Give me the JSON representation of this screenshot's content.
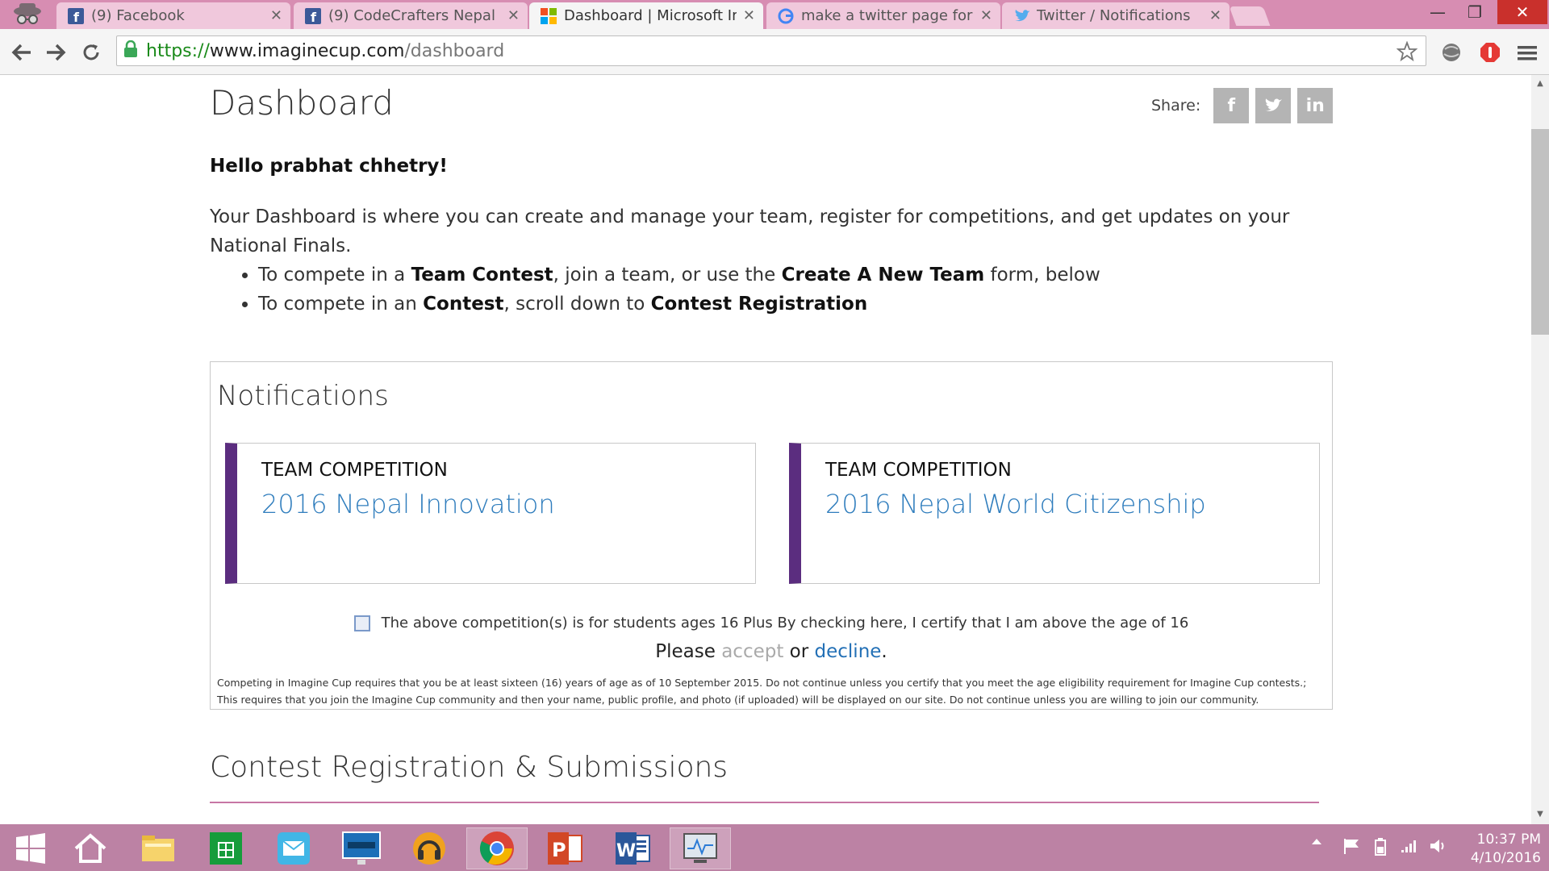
{
  "browser": {
    "tabs": [
      {
        "label": "(9) Facebook",
        "icon": "facebook-icon",
        "active": false
      },
      {
        "label": "(9) CodeCrafters Nepal",
        "icon": "facebook-icon",
        "active": false
      },
      {
        "label": "Dashboard | Microsoft Ima",
        "icon": "microsoft-icon",
        "active": true
      },
      {
        "label": "make a twitter page for bu",
        "icon": "google-icon",
        "active": false
      },
      {
        "label": "Twitter / Notifications",
        "icon": "twitter-icon",
        "active": false
      }
    ],
    "url": {
      "scheme": "https://",
      "host": "www.imaginecup.com",
      "path": "/dashboard"
    }
  },
  "page": {
    "title": "Dashboard",
    "share_label": "Share:",
    "share_buttons": [
      "f",
      "t",
      "in"
    ],
    "greeting": "Hello prabhat chhetry!",
    "intro": "Your Dashboard is where you can create and manage your team, register for competitions, and get updates on your National Finals.",
    "bullet1": {
      "a": "To compete in a ",
      "b": "Team Contest",
      "c": ", join a team, or use the ",
      "d": "Create A New Team",
      "e": " form, below"
    },
    "bullet2": {
      "a": "To compete in an ",
      "b": "Contest",
      "c": ", scroll down to ",
      "d": "Contest Registration"
    },
    "notifications": {
      "title": "Notifications",
      "cards": [
        {
          "type": "TEAM COMPETITION",
          "name": "2016 Nepal Innovation"
        },
        {
          "type": "TEAM COMPETITION",
          "name": "2016 Nepal World Citizenship"
        }
      ],
      "certify": "The above competition(s) is for students ages 16 Plus By checking here, I certify that I am above the age of 16",
      "accept_prefix": "Please ",
      "accept": "accept",
      "or": " or ",
      "decline": "decline",
      "period": ".",
      "fine1": "Competing in Imagine Cup requires that you be at least sixteen (16) years of age as of 10 September 2015. Do not continue unless you certify that you meet the age eligibility requirement for Imagine Cup contests.;",
      "fine2": "This requires that you join the Imagine Cup community and then your name, public profile, and photo (if uploaded) will be displayed on our site. Do not continue unless you are willing to join our community."
    },
    "contest_title": "Contest Registration & Submissions"
  },
  "taskbar": {
    "time": "10:37 PM",
    "date": "4/10/2016",
    "apps": [
      "windows-start-icon",
      "home-icon",
      "file-explorer-icon",
      "store-icon",
      "mail-icon",
      "lenovo-monitor-icon",
      "headphones-app-icon",
      "chrome-icon",
      "powerpoint-icon",
      "word-icon",
      "resource-monitor-icon"
    ]
  },
  "colors": {
    "accent_purple": "#5b2d7f",
    "link_blue": "#2f7dbd",
    "taskbar": "#bc82a4",
    "titlebar": "#d78db2"
  }
}
